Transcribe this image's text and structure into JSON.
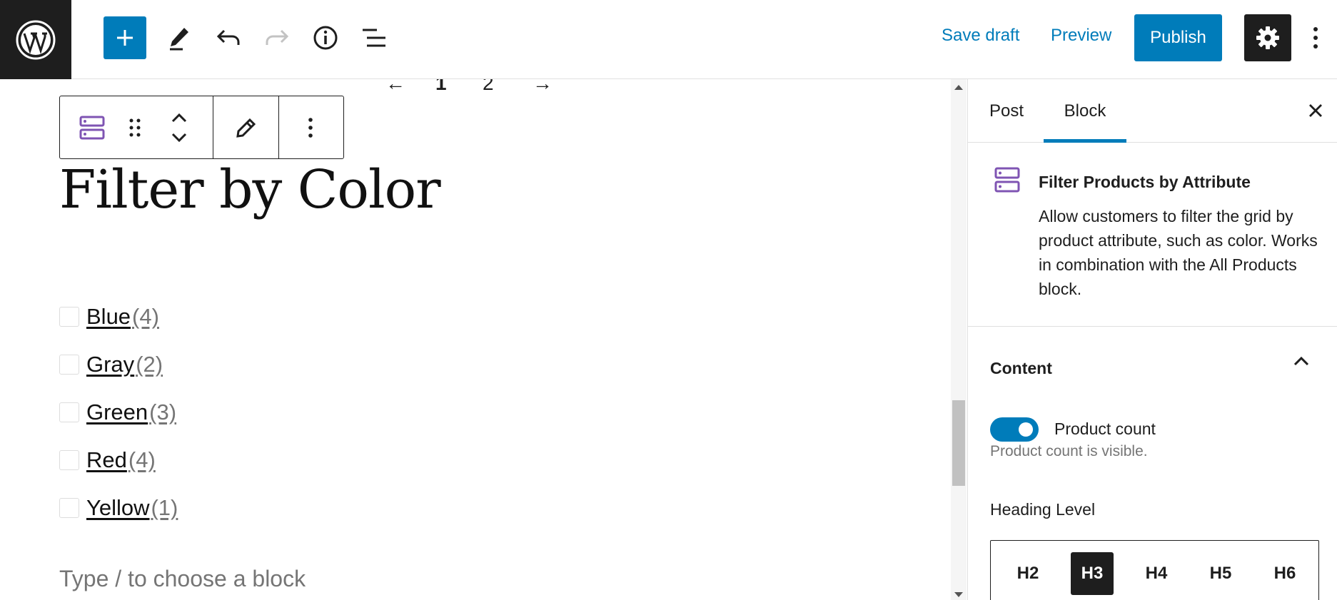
{
  "topbar": {
    "save_draft": "Save draft",
    "preview": "Preview",
    "publish": "Publish"
  },
  "canvas": {
    "pager": {
      "prev": "←",
      "page1": "1",
      "page2": "2",
      "next": "→"
    },
    "heading": "Filter by Color",
    "filters": [
      {
        "label": "Blue",
        "count": "(4)"
      },
      {
        "label": "Gray",
        "count": "(2)"
      },
      {
        "label": "Green",
        "count": "(3)"
      },
      {
        "label": "Red",
        "count": "(4)"
      },
      {
        "label": "Yellow",
        "count": "(1)"
      }
    ],
    "placeholder": "Type / to choose a block"
  },
  "sidebar": {
    "tabs": {
      "post": "Post",
      "block": "Block"
    },
    "block_card": {
      "title": "Filter Products by Attribute",
      "description": "Allow customers to filter the grid by product attribute, such as color. Works in combination with the All Products block."
    },
    "content_panel": {
      "title": "Content",
      "toggle_label": "Product count",
      "toggle_on": true,
      "help_text": "Product count is visible.",
      "heading_level_label": "Heading Level",
      "heading_levels": [
        "H2",
        "H3",
        "H4",
        "H5",
        "H6"
      ],
      "selected_level": "H3"
    }
  },
  "colors": {
    "accent": "#007cba",
    "dark": "#1e1e1e",
    "block_icon": "#7f54b3",
    "muted": "#757575"
  }
}
